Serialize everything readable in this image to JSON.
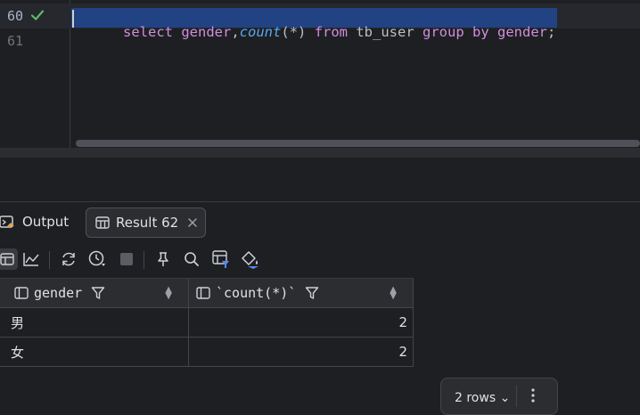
{
  "editor": {
    "lines": [
      {
        "number": "60",
        "tokens": [
          {
            "text": "select",
            "kind": "kw"
          },
          {
            "text": " ",
            "kind": "plain"
          },
          {
            "text": "gender",
            "kind": "kw"
          },
          {
            "text": ",",
            "kind": "plain"
          },
          {
            "text": "count",
            "kind": "fn"
          },
          {
            "text": "(*) ",
            "kind": "plain"
          },
          {
            "text": "from",
            "kind": "kw"
          },
          {
            "text": " tb_user ",
            "kind": "plain"
          },
          {
            "text": "group by",
            "kind": "kw"
          },
          {
            "text": " ",
            "kind": "plain"
          },
          {
            "text": "gender",
            "kind": "kw"
          },
          {
            "text": ";",
            "kind": "plain"
          }
        ],
        "status_icon": "checkmark-icon"
      },
      {
        "number": "61",
        "tokens": []
      }
    ]
  },
  "tabs": {
    "output_label": "Output",
    "result_label": "Result 62",
    "result_close_icon": "close-icon"
  },
  "toolbar": {
    "icons": [
      "table-view-icon",
      "chart-view-icon",
      "refresh-icon",
      "history-icon",
      "stop-icon",
      "pin-icon",
      "search-icon",
      "filter-table-icon",
      "paint-bucket-icon"
    ]
  },
  "grid": {
    "columns": [
      "gender",
      "`count(*)`"
    ],
    "rows": [
      [
        "男",
        "2"
      ],
      [
        "女",
        "2"
      ]
    ]
  },
  "footer": {
    "rows_label": "2 rows",
    "more_icon": "more-vertical-icon"
  },
  "colors": {
    "background": "#1e1f22",
    "selection": "#214283",
    "keyword": "#cf8ee0",
    "function": "#56a8f5",
    "success": "#5fb865"
  }
}
